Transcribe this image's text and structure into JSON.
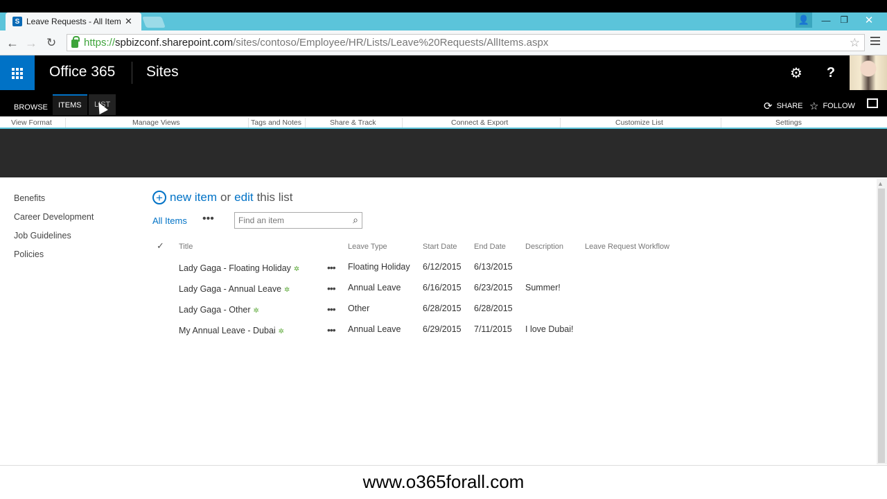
{
  "browser": {
    "tab_title": "Leave Requests - All Items",
    "tab_close": "✕",
    "favicon": "S",
    "url_scheme": "https://",
    "url_host": "spbizconf.sharepoint.com",
    "url_path": "/sites/contoso/Employee/HR/Lists/Leave%20Requests/AllItems.aspx",
    "back": "←",
    "forward": "→",
    "reload": "↻",
    "bookmark": "☆",
    "win_user": "👤",
    "win_min": "—",
    "win_max": "❐",
    "win_close": "✕"
  },
  "suite": {
    "brand": "Office 365",
    "section": "Sites",
    "settings_icon": "⚙",
    "help_icon": "?"
  },
  "ribbon": {
    "tabs": [
      "BROWSE",
      "ITEMS",
      "LIST"
    ],
    "share": "SHARE",
    "follow": "FOLLOW",
    "share_icon": "⟳",
    "follow_icon": "☆",
    "groups": [
      "View Format",
      "Manage Views",
      "Tags and Notes",
      "Share & Track",
      "Connect & Export",
      "Customize List",
      "Settings"
    ]
  },
  "leftnav": [
    "Benefits",
    "Career Development",
    "Job Guidelines",
    "Policies"
  ],
  "main": {
    "new_item": "new item",
    "or": "or",
    "edit": "edit",
    "this_list": "this list",
    "view_name": "All Items",
    "more": "•••",
    "search_placeholder": "Find an item",
    "search_icon": "⌕",
    "check_icon": "✓",
    "columns": [
      "Title",
      "Leave Type",
      "Start Date",
      "End Date",
      "Description",
      "Leave Request Workflow"
    ],
    "rows": [
      {
        "title": "Lady Gaga - Floating Holiday",
        "type": "Floating Holiday",
        "start": "6/12/2015",
        "end": "6/13/2015",
        "desc": ""
      },
      {
        "title": "Lady Gaga - Annual Leave",
        "type": "Annual Leave",
        "start": "6/16/2015",
        "end": "6/23/2015",
        "desc": "Summer!"
      },
      {
        "title": "Lady Gaga - Other",
        "type": "Other",
        "start": "6/28/2015",
        "end": "6/28/2015",
        "desc": ""
      },
      {
        "title": "My Annual Leave - Dubai",
        "type": "Annual Leave",
        "start": "6/29/2015",
        "end": "7/11/2015",
        "desc": "I love Dubai!"
      }
    ],
    "new_badge": "✲"
  },
  "watermark": "www.o365forall.com",
  "colors": {
    "accent": "#0072c6",
    "chrome": "#5bc4da",
    "new_badge": "#5ba838"
  }
}
